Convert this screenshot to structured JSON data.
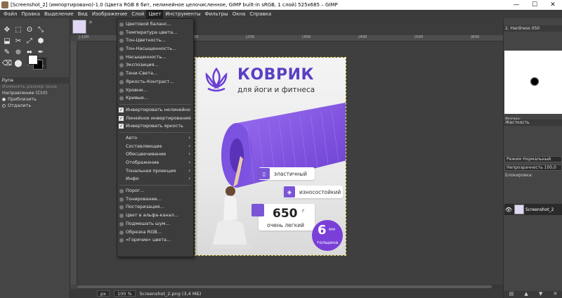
{
  "window": {
    "title": "[Screenshot_2] (импортировано)-1.0 (Цвета RGB 8 бит, нелинейное целочисленное, GIMP built-in sRGB, 1 слой) 525x685 – GIMP",
    "minimize": "—",
    "maximize": "☐",
    "close": "✕"
  },
  "menubar": [
    "Файл",
    "Правка",
    "Выделение",
    "Вид",
    "Изображение",
    "Слой",
    "Цвет",
    "Инструменты",
    "Фильтры",
    "Окна",
    "Справка"
  ],
  "toolbox": {
    "tools": [
      "✥",
      "⬚",
      "ʘ",
      "⤡",
      "⬓",
      "✂",
      "⤢",
      "⬢",
      "✎",
      "⊕",
      "⬌",
      "✒",
      "⌫",
      "⬤",
      "⁄",
      "🔍"
    ],
    "options_title": "Лупа",
    "options": {
      "auto_resize": "Изменять размер окна",
      "direction_label": "Направление (Ctrl)",
      "zoom_in": "Приблизить",
      "zoom_out": "Отдалить"
    }
  },
  "tabs": {
    "close": "✕"
  },
  "rulers": {
    "top": [
      "|-100",
      "|0",
      "|100",
      "|200",
      "|300",
      "|400",
      "|500",
      "|600"
    ]
  },
  "color_menu": {
    "group1": [
      "Цветовой баланс...",
      "Температура цвета...",
      "Тон-Цветность...",
      "Тон-Насыщенность...",
      "Насыщенность...",
      "Экспозиция...",
      "Тени-Света...",
      "Яркость-Контраст...",
      "Уровни...",
      "Кривые..."
    ],
    "group2": [
      "Инвертировать нелинейно",
      "Линейное инвертирование",
      "Инвертировать яркость"
    ],
    "group3": [
      "Авто",
      "Составляющие",
      "Обесцвечивание",
      "Отображение",
      "Тональная проекция",
      "Инфо"
    ],
    "group4": [
      "Порог...",
      "Тонирование...",
      "Постеризация...",
      "Цвет в альфа-канал...",
      "Подмешать шум...",
      "Обрезка RGB...",
      "«Горячие» цвета..."
    ],
    "submenu_arrow": "›",
    "check_mark": "✓"
  },
  "poster": {
    "title": "КОВРИК",
    "subtitle": "для йоги и фитнеса",
    "feature1": "эластичный",
    "feature2": "износостойкий",
    "weight": "650",
    "weight_unit": "г",
    "weight_label": "очень легкий",
    "thickness": "6",
    "thickness_unit": "мм",
    "thickness_label": "толщина",
    "accent_color": "#6b3fd4"
  },
  "statusbar": {
    "unit": "px",
    "zoom": "100 %",
    "file": "Screenshot_2.png (3,4 МБ)"
  },
  "dock": {
    "brush_name": "2. Hardness 050",
    "shape_label": "Форма:",
    "hardness_label": "Жесткость",
    "mode_label": "Режим",
    "mode_value": "Нормальный",
    "opacity_label": "Непрозрачность",
    "opacity_value": "100,0",
    "lock_label": "Блокировка:",
    "layer_name": "Screenshot_2",
    "eye": "👁"
  }
}
